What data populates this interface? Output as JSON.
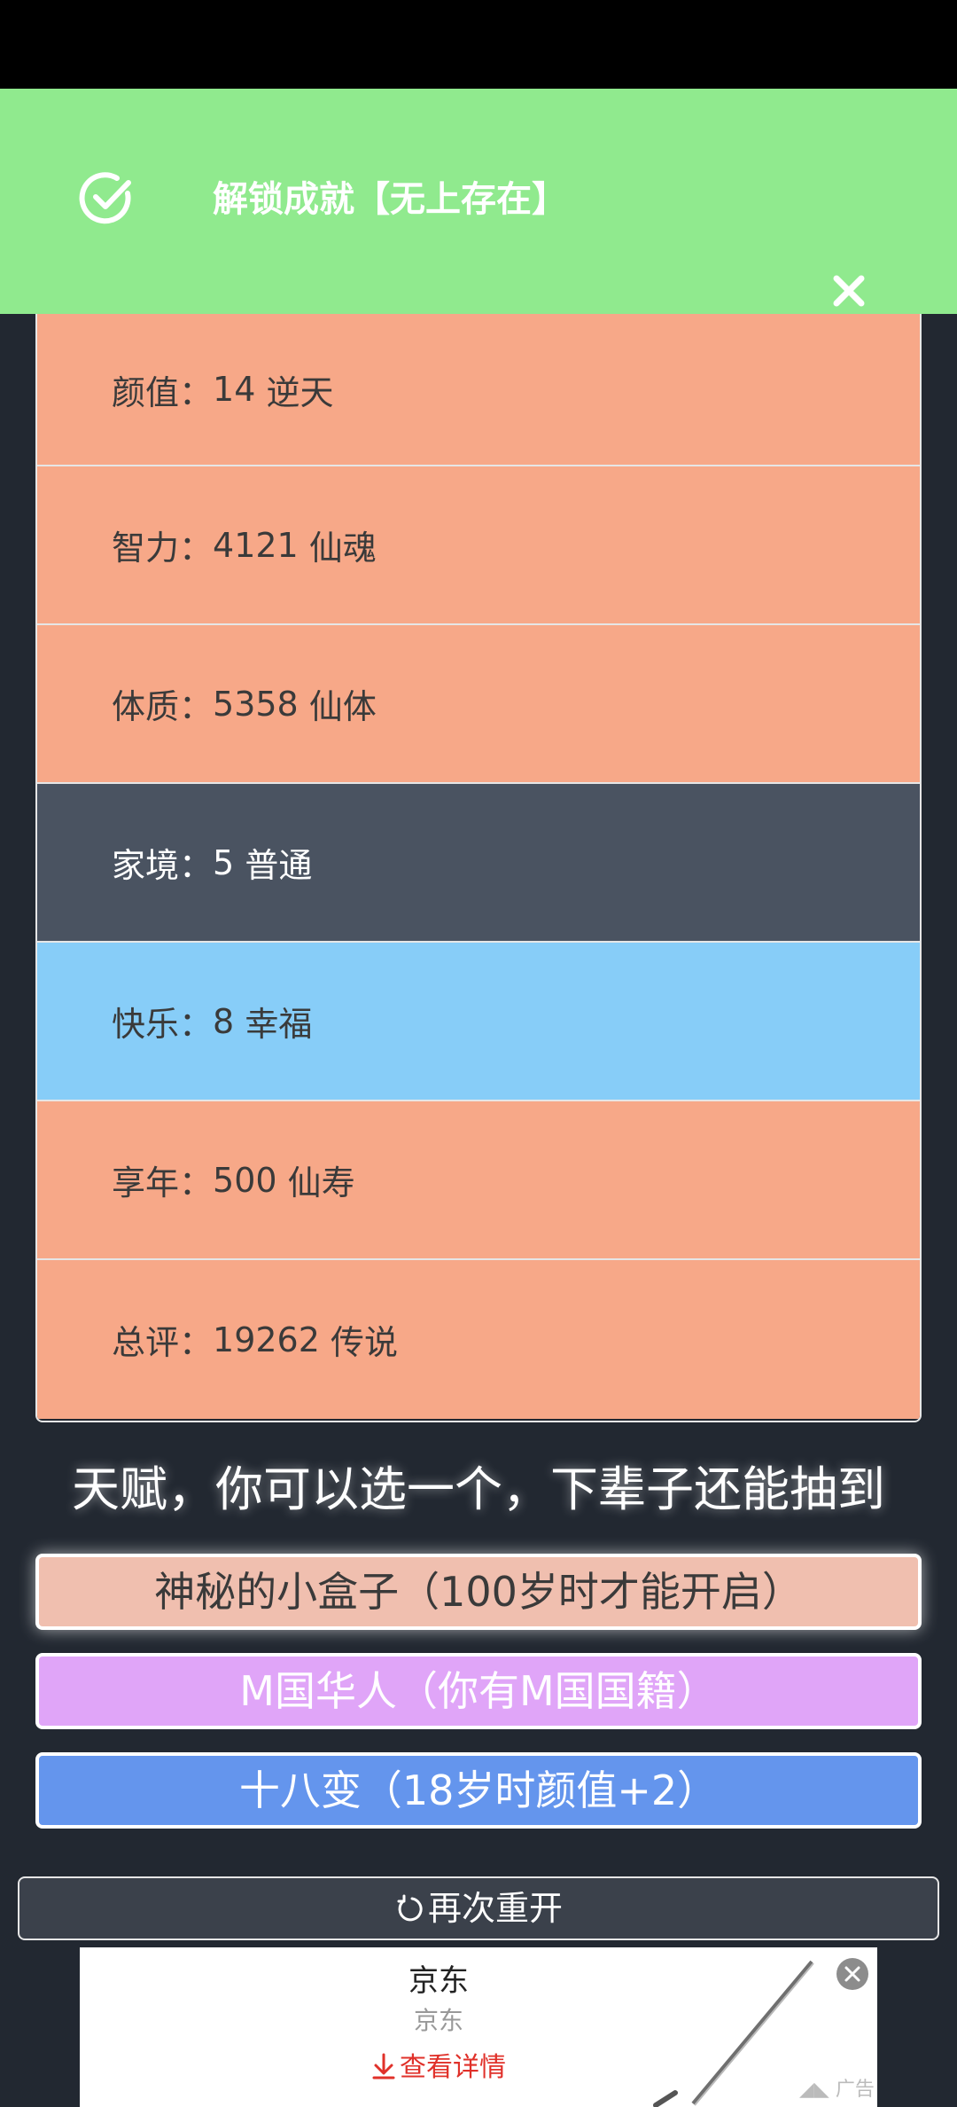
{
  "toast": {
    "text": "解锁成就【无上存在】",
    "check_icon": "check-circle-icon",
    "close_icon": "close-icon",
    "background": "#90ea8e"
  },
  "stats": [
    {
      "label": "颜值",
      "value": "14",
      "rank": "逆天",
      "color": "#f7a888"
    },
    {
      "label": "智力",
      "value": "4121",
      "rank": "仙魂",
      "color": "#f7a888"
    },
    {
      "label": "体质",
      "value": "5358",
      "rank": "仙体",
      "color": "#f7a888"
    },
    {
      "label": "家境",
      "value": "5",
      "rank": "普通",
      "color": "#4a5361"
    },
    {
      "label": "快乐",
      "value": "8",
      "rank": "幸福",
      "color": "#87cdf8"
    },
    {
      "label": "享年",
      "value": "500",
      "rank": "仙寿",
      "color": "#f7a888"
    },
    {
      "label": "总评",
      "value": "19262",
      "rank": "传说",
      "color": "#f7a888"
    }
  ],
  "talent_title": "天赋，你可以选一个，下辈子还能抽到",
  "talents": [
    {
      "label": "神秘的小盒子（100岁时才能开启）",
      "color": "#f0bfaf"
    },
    {
      "label": "M国华人（你有M国国籍）",
      "color": "#e0a5f8"
    },
    {
      "label": "十八变（18岁时颜值+2）",
      "color": "#6495ed"
    }
  ],
  "restart": {
    "label": "再次重开",
    "icon": "refresh-icon"
  },
  "ad": {
    "title": "京东",
    "subtitle": "京东",
    "link": "查看详情",
    "link_icon": "download-arrow-icon",
    "close_icon": "close-circle-icon",
    "label": "广告"
  }
}
